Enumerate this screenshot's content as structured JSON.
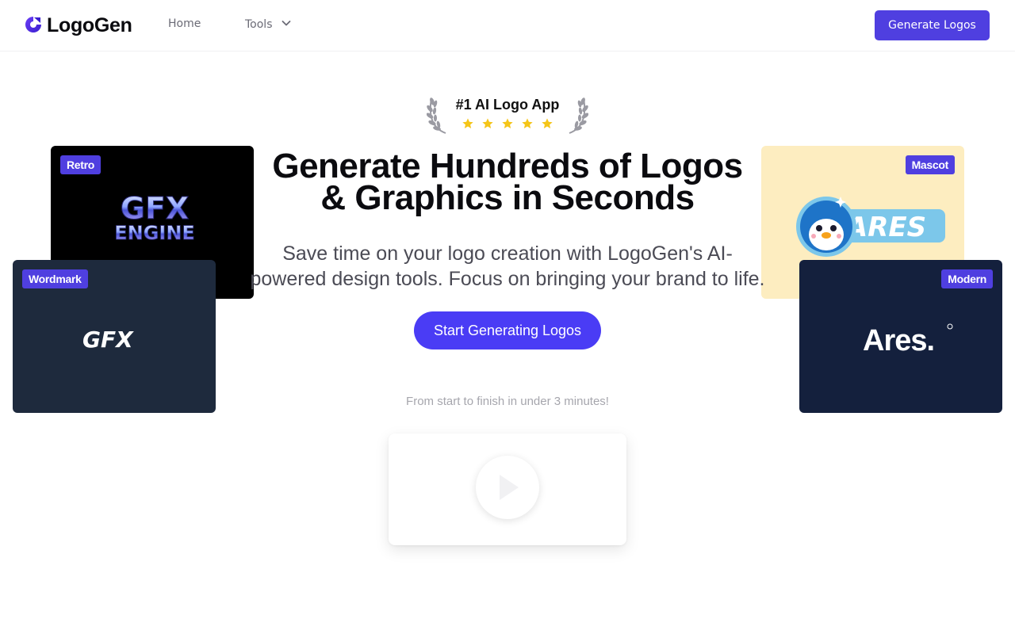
{
  "header": {
    "brand_name": "LogoGen",
    "nav": {
      "home": "Home",
      "tools": "Tools"
    },
    "cta_label": "Generate Logos"
  },
  "award": {
    "title": "#1 AI Logo App",
    "stars": 5
  },
  "hero": {
    "title_line1": "Generate Hundreds of Logos",
    "title_line2": "& Graphics in Seconds",
    "subtitle_line1": "Save time on your logo creation with LogoGen's AI-",
    "subtitle_line2": "powered design tools. Focus on bringing your brand to life.",
    "cta_label": "Start Generating Logos",
    "tagline": "From start to finish in under 3 minutes!"
  },
  "cards": {
    "retro": {
      "badge": "Retro",
      "logo_line1": "GFX",
      "logo_line2": "ENGINE"
    },
    "wordmark": {
      "badge": "Wordmark",
      "logo": "GFX"
    },
    "mascot": {
      "badge": "Mascot",
      "logo": "ARES"
    },
    "modern": {
      "badge": "Modern",
      "logo": "Ares."
    }
  },
  "colors": {
    "accent": "#4f3fe0",
    "cta": "#4a3cf5",
    "star": "#f5c518"
  }
}
